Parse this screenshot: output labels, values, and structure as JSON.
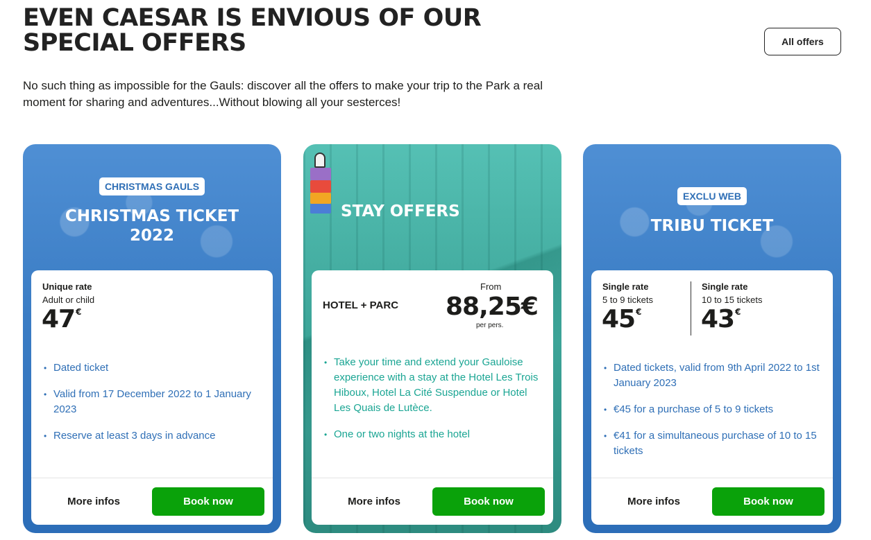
{
  "header": {
    "title": "EVEN CAESAR IS ENVIOUS OF OUR SPECIAL OFFERS",
    "intro": "No such thing as impossible for the Gauls: discover all the offers to make your trip to the Park a real moment for sharing and adventures...Without blowing all your sesterces!",
    "all_offers_label": "All offers"
  },
  "cards": [
    {
      "badge": "CHRISTMAS GAULS",
      "title_line1": "CHRISTMAS TICKET",
      "title_line2": "2022",
      "rate_label": "Unique rate",
      "rate_sub": "Adult or child",
      "price": "47",
      "currency": "€",
      "bullets": [
        "Dated ticket",
        "Valid from 17 December 2022 to 1 January 2023",
        "Reserve at least 3 days in advance"
      ],
      "more_label": "More infos",
      "book_label": "Book now"
    },
    {
      "title": "STAY OFFERS",
      "product": "HOTEL + PARC",
      "from_label": "From",
      "price": "88,25€",
      "per_label": "per pers.",
      "bullets": [
        "Take your time and extend your Gauloise experience with a stay at the Hotel Les Trois Hiboux, Hotel La Cité Suspendue or Hotel Les Quais de Lutèce.",
        "One or two nights at the hotel"
      ],
      "more_label": "More infos",
      "book_label": "Book now"
    },
    {
      "badge": "EXCLU WEB",
      "title": "TRIBU TICKET",
      "rate1_label": "Single rate",
      "rate1_sub": "5 to 9 tickets",
      "rate1_price": "45",
      "rate2_label": "Single rate",
      "rate2_sub": "10 to 15 tickets",
      "rate2_price": "43",
      "currency": "€",
      "bullets": [
        "Dated tickets, valid from 9th April 2022 to 1st January 2023",
        "€45 for a purchase of 5 to 9 tickets",
        "€41 for a simultaneous purchase of 10 to 15 tickets"
      ],
      "more_label": "More infos",
      "book_label": "Book now"
    }
  ]
}
